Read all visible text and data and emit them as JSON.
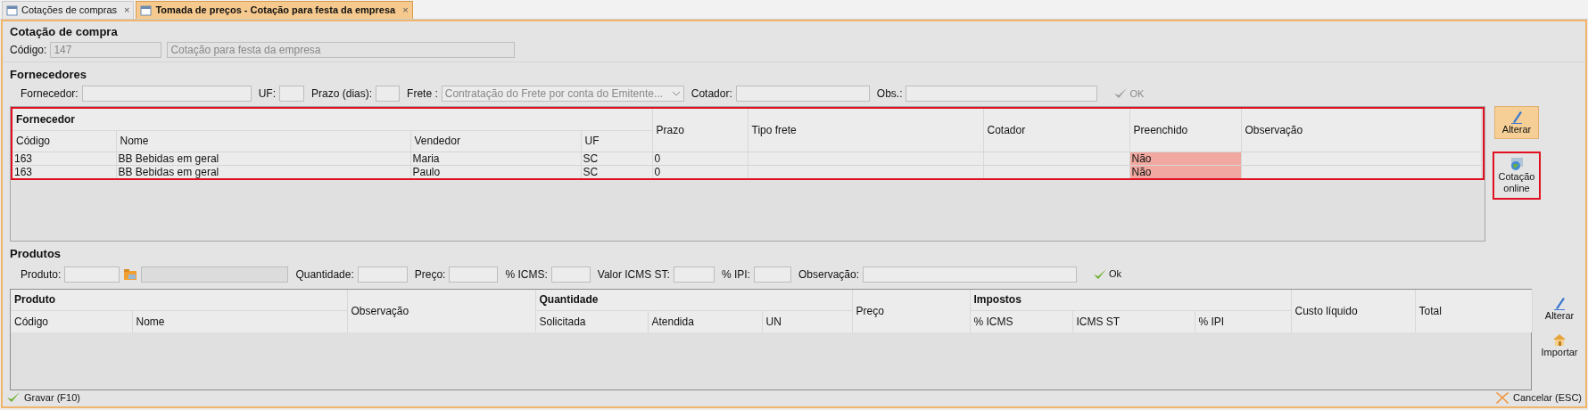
{
  "tabs": [
    {
      "label": "Cotações de compras",
      "selected": false,
      "close": "×"
    },
    {
      "label": "Tomada de preços - Cotação para festa da empresa",
      "selected": true,
      "close": "×"
    }
  ],
  "quote": {
    "title": "Cotação de compra",
    "code_label": "Código:",
    "code_value": "147",
    "description": "Cotação para festa da empresa"
  },
  "suppliers": {
    "title": "Fornecedores",
    "filters": [
      {
        "kind": "field",
        "label": "Fornecedor:"
      },
      {
        "kind": "field",
        "label": "UF:"
      },
      {
        "kind": "field",
        "label": "Prazo (dias):"
      },
      {
        "kind": "select",
        "label": "Frete :",
        "value": "Contratação do Frete por conta do Emitente..."
      },
      {
        "kind": "field",
        "label": "Cotador:"
      },
      {
        "kind": "field",
        "label": "Obs.:"
      }
    ],
    "ok_button": {
      "label": "OK",
      "disabled": true
    },
    "table": {
      "header": [
        {
          "label": "Fornecedor",
          "children": [
            "Código",
            "Nome",
            "Vendedor",
            "UF"
          ]
        },
        {
          "label": "Prazo"
        },
        {
          "label": "Tipo frete"
        },
        {
          "label": "Cotador"
        },
        {
          "label": "Preenchido"
        },
        {
          "label": "Observação"
        }
      ],
      "rows": [
        {
          "code": "163",
          "name": "BB Bebidas em geral",
          "seller": "Maria",
          "uf": "SC",
          "term": "0",
          "filled": false,
          "filled_text": "Não"
        },
        {
          "code": "163",
          "name": "BB Bebidas em geral",
          "seller": "Paulo",
          "uf": "SC",
          "term": "0",
          "filled": false,
          "filled_text": "Não"
        }
      ]
    },
    "side_buttons": [
      {
        "kind": "edit",
        "label": "Alterar",
        "active": true,
        "highlighted": false
      },
      {
        "kind": "online",
        "label": "Cotação online",
        "active": false,
        "highlighted": true
      }
    ]
  },
  "products": {
    "title": "Produtos",
    "filters": [
      {
        "kind": "field",
        "label": "Produto:"
      },
      {
        "kind": "lookup"
      },
      {
        "kind": "field",
        "label": "Quantidade:"
      },
      {
        "kind": "field",
        "label": "Preço:"
      },
      {
        "kind": "field",
        "label": "% ICMS:"
      },
      {
        "kind": "field",
        "label": "Valor ICMS ST:"
      },
      {
        "kind": "field",
        "label": "% IPI:"
      },
      {
        "kind": "field",
        "label": "Observação:"
      }
    ],
    "ok_button": {
      "label": "Ok",
      "disabled": false
    },
    "table": {
      "header": [
        {
          "label": "Produto",
          "children": [
            "Código",
            "Nome"
          ]
        },
        {
          "label": "Observação"
        },
        {
          "label": "Quantidade",
          "children": [
            "Solicitada",
            "Atendida",
            "UN"
          ]
        },
        {
          "label": "Preço"
        },
        {
          "label": "Impostos",
          "children": [
            "% ICMS",
            "ICMS ST",
            "% IPI"
          ]
        },
        {
          "label": "Custo líquido"
        },
        {
          "label": "Total"
        }
      ]
    },
    "side_buttons": [
      {
        "kind": "edit",
        "label": "Alterar",
        "active": false,
        "highlighted": false
      },
      {
        "kind": "import",
        "label": "Importar",
        "active": false,
        "highlighted": false
      }
    ]
  },
  "footer": {
    "save": "Gravar (F10)",
    "cancel": "Cancelar (ESC)"
  }
}
